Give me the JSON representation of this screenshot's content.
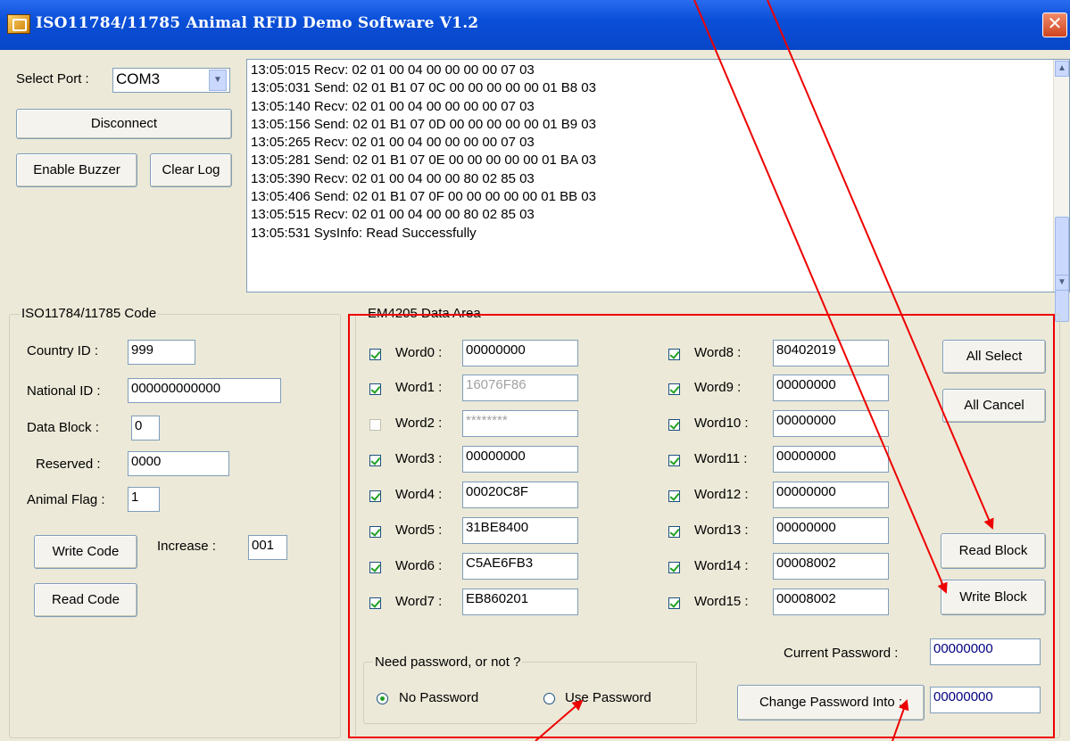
{
  "window": {
    "title": "ISO11784/11785 Animal RFID Demo Software V1.2",
    "close_glyph": "✕"
  },
  "port": {
    "label": "Select Port :",
    "value": "COM3",
    "disconnect": "Disconnect",
    "enable_buzzer": "Enable Buzzer",
    "clear_log": "Clear Log"
  },
  "log": [
    "13:05:015 Recv: 02 01 00 04 00 00 00 00 07 03",
    "13:05:031 Send: 02 01 B1 07 0C 00 00 00 00 00 01 B8 03",
    "13:05:140 Recv: 02 01 00 04 00 00 00 00 07 03",
    "13:05:156 Send: 02 01 B1 07 0D 00 00 00 00 00 01 B9 03",
    "13:05:265 Recv: 02 01 00 04 00 00 00 00 07 03",
    "13:05:281 Send: 02 01 B1 07 0E 00 00 00 00 00 01 BA 03",
    "13:05:390 Recv: 02 01 00 04 00 00 80 02 85 03",
    "13:05:406 Send: 02 01 B1 07 0F 00 00 00 00 00 01 BB 03",
    "13:05:515 Recv: 02 01 00 04 00 00 80 02 85 03",
    "13:05:531 SysInfo: Read Successfully"
  ],
  "iso": {
    "group_title": "ISO11784/11785 Code",
    "country_label": "Country ID :",
    "country_value": "999",
    "national_label": "National ID :",
    "national_value": "000000000000",
    "datablock_label": "Data  Block :",
    "datablock_value": "0",
    "reserved_label": "Reserved :",
    "reserved_value": "0000",
    "animalflag_label": "Animal Flag :",
    "animalflag_value": "1",
    "write_code": "Write Code",
    "read_code": "Read Code",
    "increase_label": "Increase :",
    "increase_value": "001"
  },
  "em": {
    "group_title": "EM4205 Data Area",
    "words": [
      {
        "label": "Word0 :",
        "value": "00000000",
        "checked": true,
        "disabled": false
      },
      {
        "label": "Word1 :",
        "value": "16076F86",
        "checked": true,
        "disabled": true
      },
      {
        "label": "Word2 :",
        "value": "********",
        "checked": false,
        "disabled": true
      },
      {
        "label": "Word3 :",
        "value": "00000000",
        "checked": true,
        "disabled": false
      },
      {
        "label": "Word4 :",
        "value": "00020C8F",
        "checked": true,
        "disabled": false
      },
      {
        "label": "Word5 :",
        "value": "31BE8400",
        "checked": true,
        "disabled": false
      },
      {
        "label": "Word6 :",
        "value": "C5AE6FB3",
        "checked": true,
        "disabled": false
      },
      {
        "label": "Word7 :",
        "value": "EB860201",
        "checked": true,
        "disabled": false
      },
      {
        "label": "Word8 :",
        "value": "80402019",
        "checked": true,
        "disabled": false
      },
      {
        "label": "Word9 :",
        "value": "00000000",
        "checked": true,
        "disabled": false
      },
      {
        "label": "Word10 :",
        "value": "00000000",
        "checked": true,
        "disabled": false
      },
      {
        "label": "Word11 :",
        "value": "00000000",
        "checked": true,
        "disabled": false
      },
      {
        "label": "Word12 :",
        "value": "00000000",
        "checked": true,
        "disabled": false
      },
      {
        "label": "Word13 :",
        "value": "00000000",
        "checked": true,
        "disabled": false
      },
      {
        "label": "Word14 :",
        "value": "00008002",
        "checked": true,
        "disabled": false
      },
      {
        "label": "Word15 :",
        "value": "00008002",
        "checked": true,
        "disabled": false
      }
    ],
    "all_select": "All Select",
    "all_cancel": "All Cancel",
    "read_block": "Read Block",
    "write_block": "Write Block",
    "password_group_title": "Need password, or not ?",
    "no_password": "No  Password",
    "use_password": "Use Password",
    "password_mode": "no",
    "current_password_label": "Current Password :",
    "current_password_value": "00000000",
    "change_password_button": "Change Password Into :",
    "new_password_value": "00000000"
  },
  "colors": {
    "window_bg": "#ECE9D8",
    "titlebar": "#0A4FD8",
    "annotation": "#EE0000",
    "checkmark": "#21A121"
  }
}
